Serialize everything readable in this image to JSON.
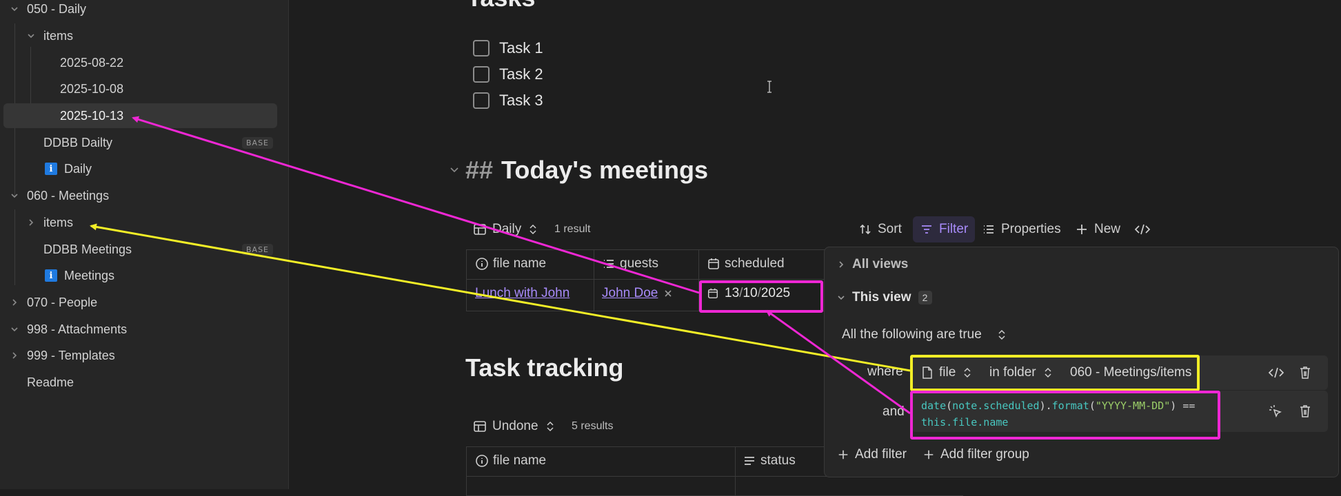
{
  "sidebar": {
    "items": [
      {
        "label": "050 - Daily"
      },
      {
        "label": "items"
      },
      {
        "label": "2025-08-22"
      },
      {
        "label": "2025-10-08"
      },
      {
        "label": "2025-10-13"
      },
      {
        "label": "DDBB Dailty",
        "badge": "BASE"
      },
      {
        "label": "Daily"
      },
      {
        "label": "060 - Meetings"
      },
      {
        "label": "items"
      },
      {
        "label": "DDBB Meetings",
        "badge": "BASE"
      },
      {
        "label": "Meetings"
      },
      {
        "label": "070 - People"
      },
      {
        "label": "998 - Attachments"
      },
      {
        "label": "999 - Templates"
      },
      {
        "label": "Readme"
      }
    ],
    "info_glyph": "i"
  },
  "main": {
    "tasks_heading": "Tasks",
    "tasks": [
      "Task 1",
      "Task 2",
      "Task 3"
    ],
    "meetings_heading_hash": "##",
    "meetings_heading": "Today's meetings",
    "meetings_view": {
      "view_name": "Daily",
      "result_count": "1 result",
      "toolbar": {
        "sort": "Sort",
        "filter": "Filter",
        "properties": "Properties",
        "new": "New"
      },
      "columns": [
        "file name",
        "guests",
        "scheduled"
      ],
      "row": {
        "file_name": "Lunch with John",
        "guest": "John Doe",
        "date_day": "13",
        "date_month": "10",
        "date_year": "2025",
        "date_sep": "/"
      }
    },
    "tracking_heading": "Task tracking",
    "tracking_view": {
      "view_name": "Undone",
      "result_count": "5 results",
      "columns": [
        "file name",
        "status"
      ]
    }
  },
  "filter_panel": {
    "all_views": "All views",
    "this_view": "This view",
    "this_view_count": "2",
    "conjunction": "All the following are true",
    "where": "where",
    "and": "and",
    "filter1": {
      "property": "file",
      "operator": "in folder",
      "value": "060 - Meetings/items"
    },
    "filter2": {
      "code_date": "date",
      "code_arg": "note.scheduled",
      "code_format": "format",
      "code_fmt_str": "\"YYYY-MM-DD\"",
      "code_eq": "==",
      "code_this": "this.file.name"
    },
    "add_filter": "Add filter",
    "add_filter_group": "Add filter group"
  },
  "annotation_colors": {
    "pink": "#ee27d4",
    "yellow": "#f2ee27"
  }
}
